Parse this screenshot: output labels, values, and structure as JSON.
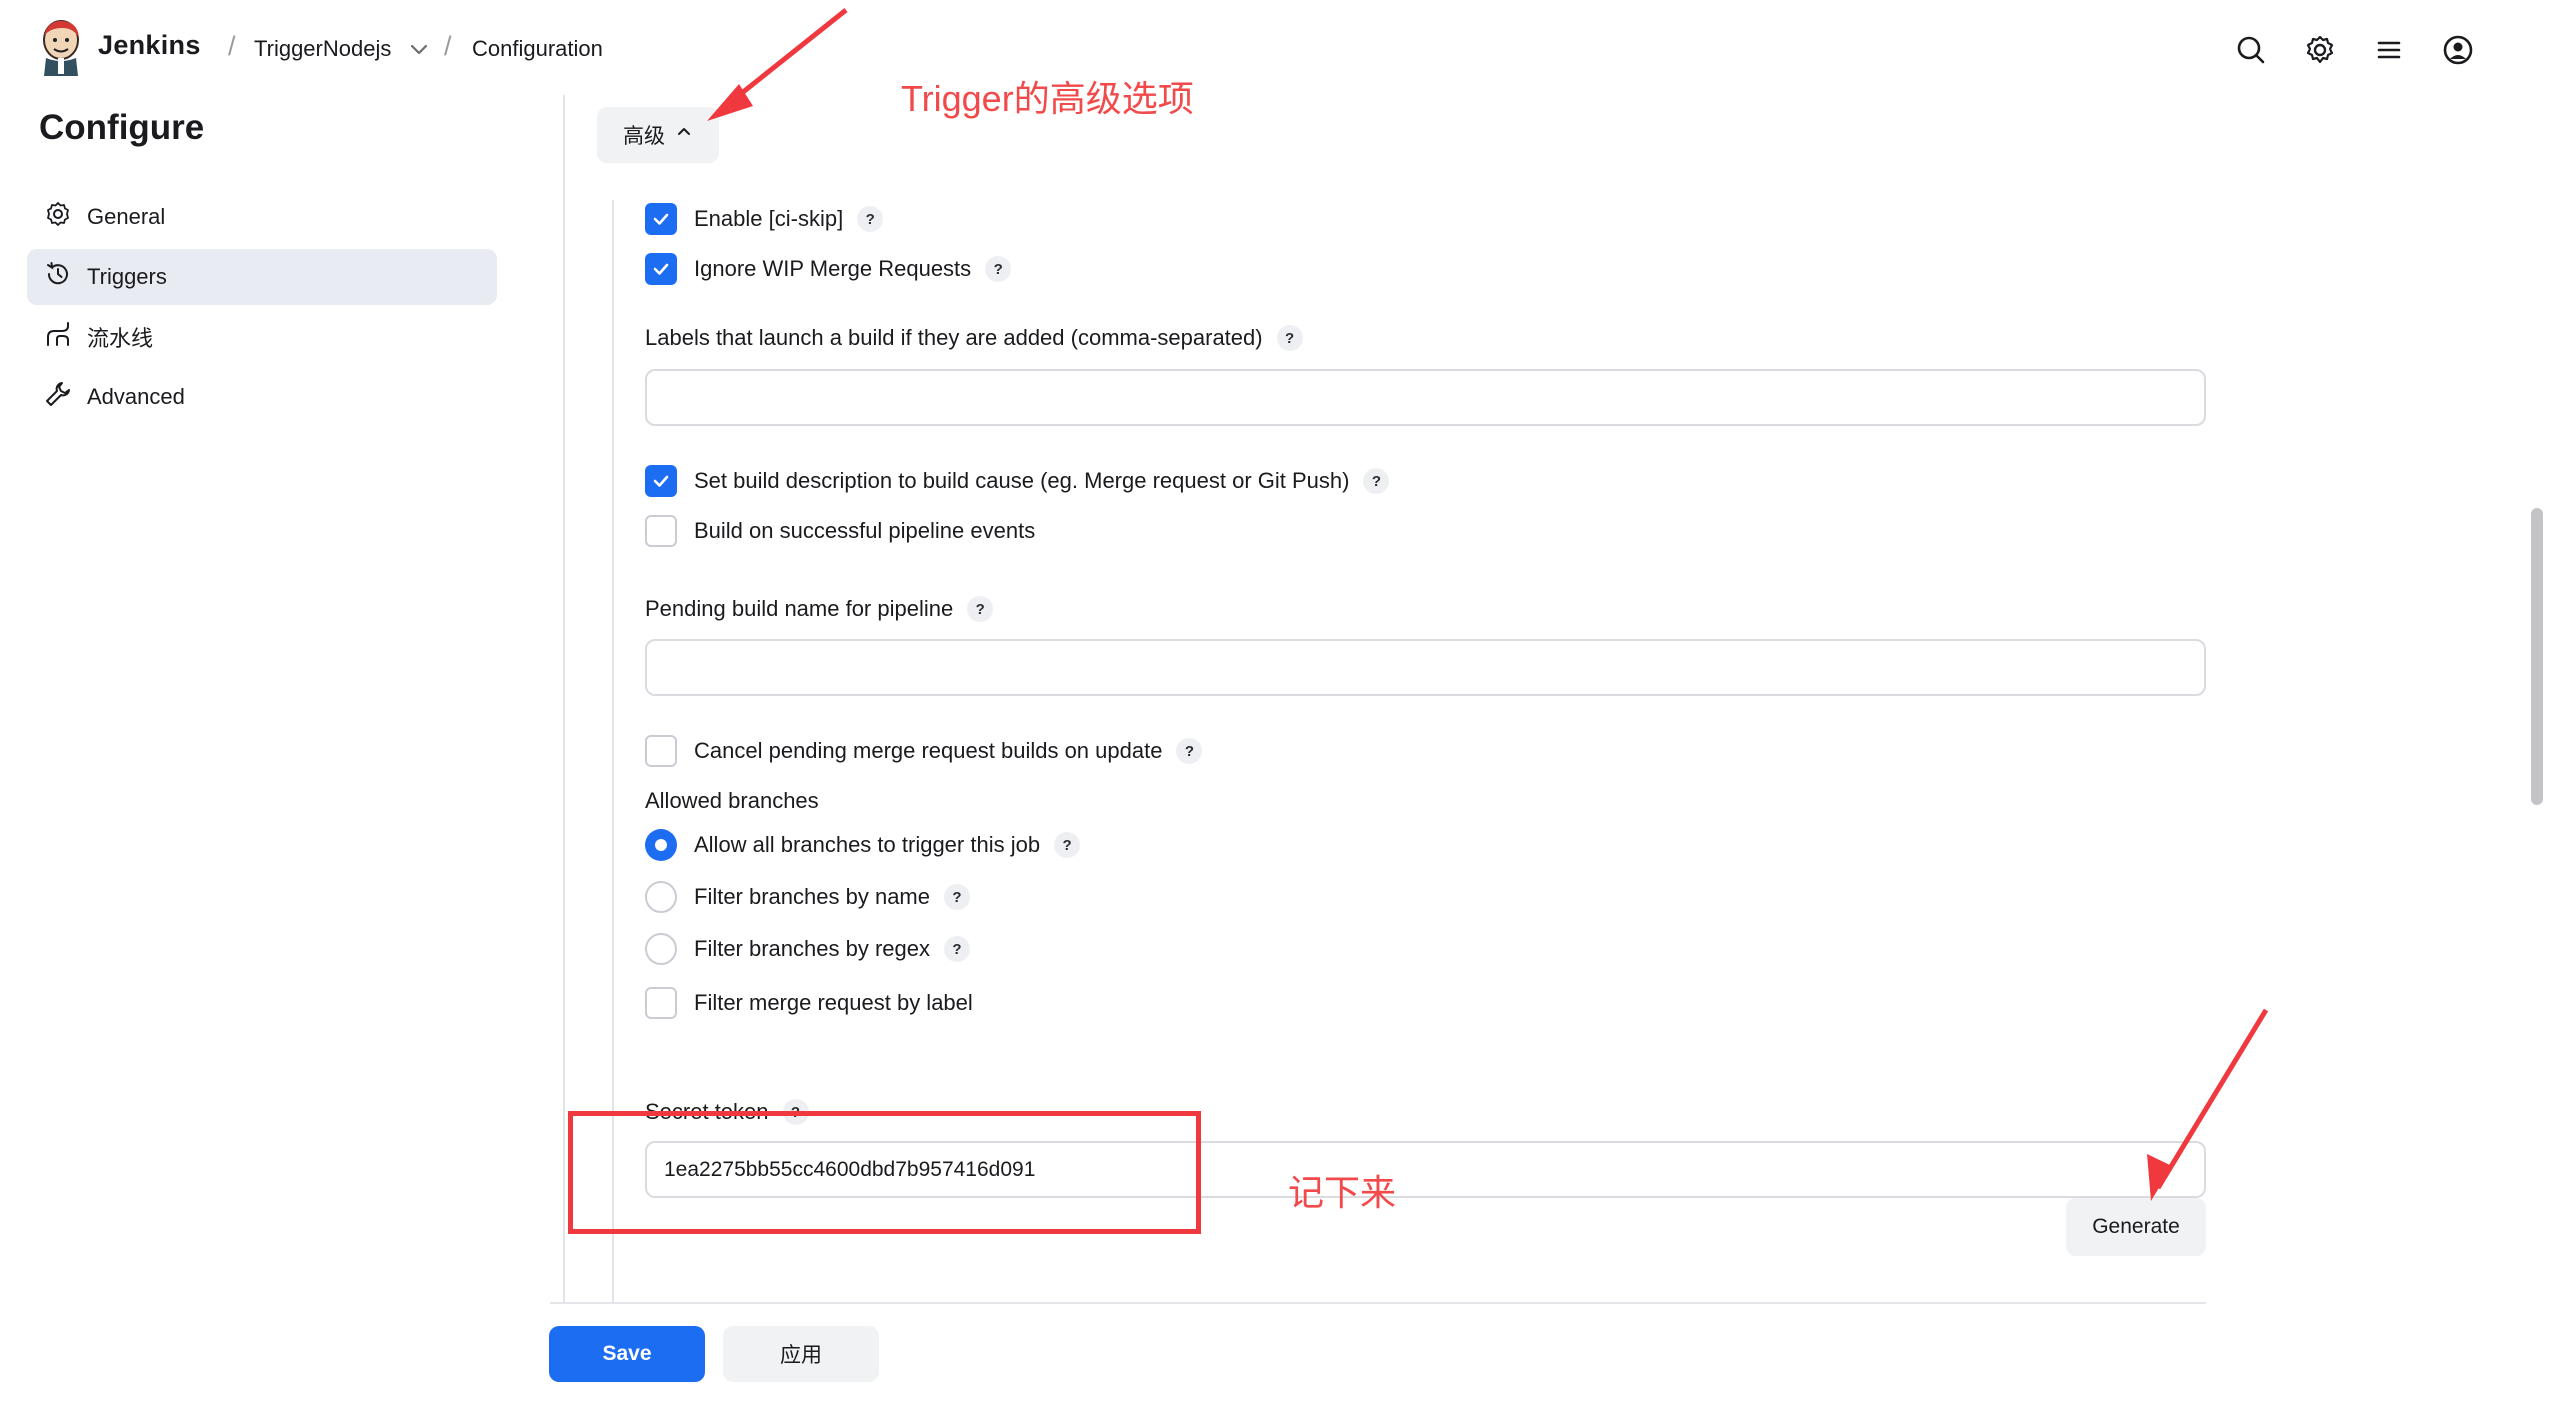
{
  "header": {
    "brand": "Jenkins",
    "breadcrumb": [
      {
        "label": "TriggerNodejs"
      },
      {
        "label": "Configuration"
      }
    ],
    "icons": [
      "search-icon",
      "gear-icon",
      "menu-icon",
      "user-icon"
    ]
  },
  "sidebar": {
    "title": "Configure",
    "items": [
      {
        "label": "General",
        "icon": "gear-icon"
      },
      {
        "label": "Triggers",
        "icon": "clock-icon",
        "active": true
      },
      {
        "label": "流水线",
        "icon": "pipeline-icon"
      },
      {
        "label": "Advanced",
        "icon": "wrench-icon"
      }
    ]
  },
  "form": {
    "advanced_toggle": "高级",
    "enable_ci_skip": {
      "label": "Enable [ci-skip]",
      "checked": true
    },
    "ignore_wip": {
      "label": "Ignore WIP Merge Requests",
      "checked": true
    },
    "labels_field": {
      "label": "Labels that launch a build if they are added (comma-separated)",
      "value": ""
    },
    "set_build_description": {
      "label": "Set build description to build cause (eg. Merge request or Git Push)",
      "checked": true
    },
    "build_on_pipeline": {
      "label": "Build on successful pipeline events",
      "checked": false
    },
    "pending_build_name": {
      "label": "Pending build name for pipeline",
      "value": ""
    },
    "cancel_pending": {
      "label": "Cancel pending merge request builds on update",
      "checked": false
    },
    "allowed_branches": {
      "label": "Allowed branches",
      "options": [
        {
          "label": "Allow all branches to trigger this job",
          "selected": true
        },
        {
          "label": "Filter branches by name",
          "selected": false
        },
        {
          "label": "Filter branches by regex",
          "selected": false
        }
      ]
    },
    "filter_mr_label": {
      "label": "Filter merge request by label",
      "checked": false
    },
    "secret_token": {
      "label": "Secret token",
      "value": "1ea2275bb55cc4600dbd7b957416d091"
    },
    "generate_button": "Generate"
  },
  "footer": {
    "save": "Save",
    "apply": "应用"
  },
  "annotations": {
    "trigger_note": "Trigger的高级选项",
    "token_note": "记下来",
    "color": "#f24a4a"
  },
  "colors": {
    "accent": "#1d6df2",
    "active_nav_bg": "#e8ebf2"
  }
}
